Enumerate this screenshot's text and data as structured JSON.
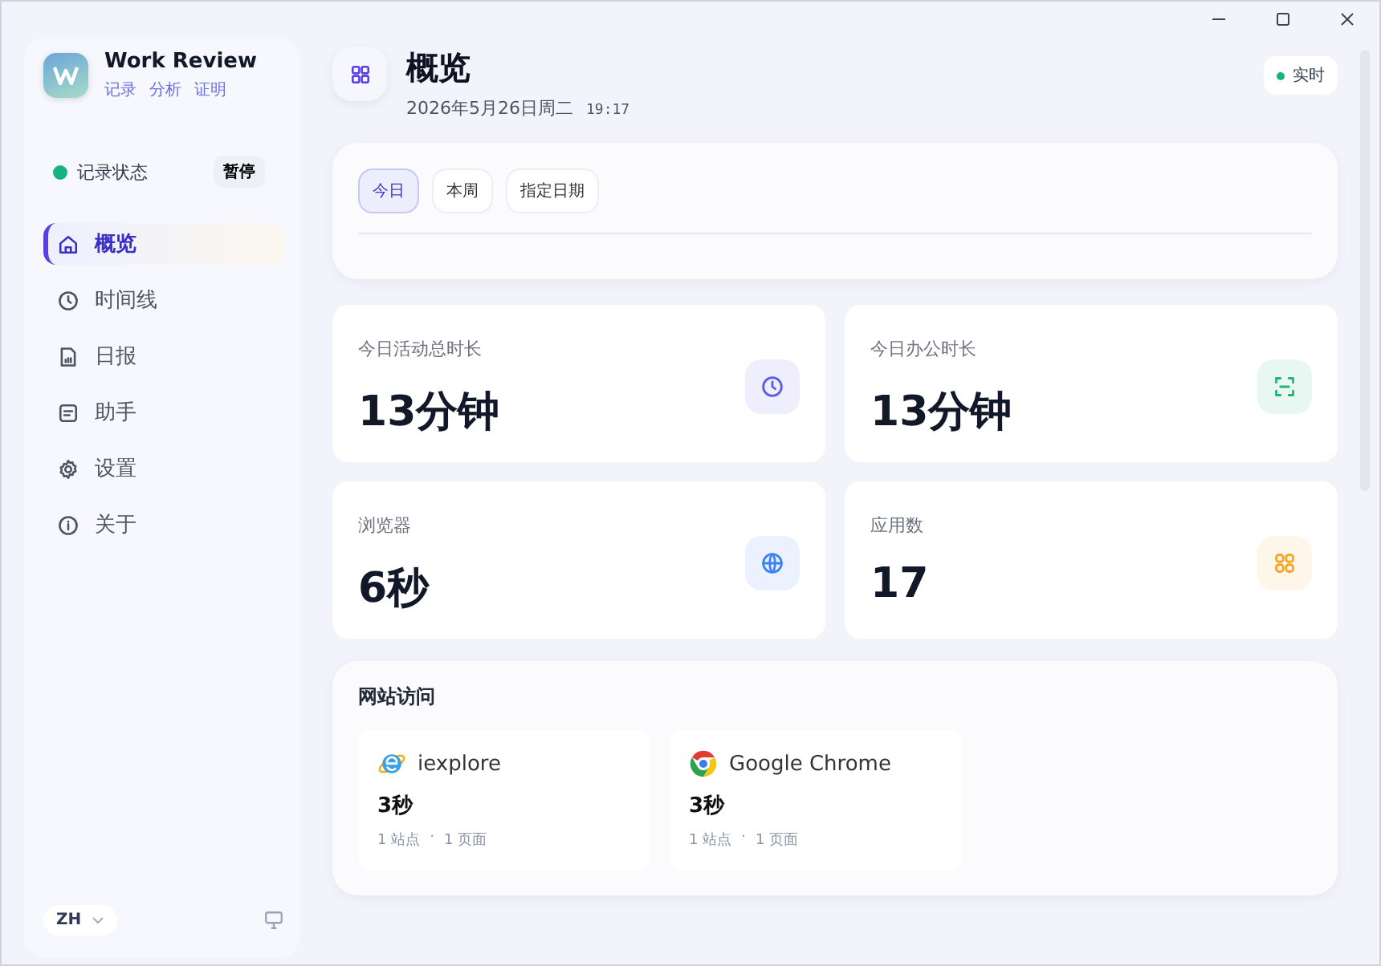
{
  "app": {
    "name": "Work Review",
    "links": [
      "记录",
      "分析",
      "证明"
    ]
  },
  "recording": {
    "label": "记录状态",
    "active": true,
    "action": "暂停"
  },
  "sidebar": {
    "items": [
      {
        "label": "概览",
        "selected": true
      },
      {
        "label": "时间线",
        "selected": false
      },
      {
        "label": "日报",
        "selected": false
      },
      {
        "label": "助手",
        "selected": false
      },
      {
        "label": "设置",
        "selected": false
      },
      {
        "label": "关于",
        "selected": false
      }
    ]
  },
  "language": {
    "value": "ZH"
  },
  "header": {
    "title": "概览",
    "date": "2026年5月26日周二",
    "time": "19:17",
    "live": {
      "label": "实时",
      "on": true
    }
  },
  "range_tabs": [
    {
      "label": "今日",
      "selected": true
    },
    {
      "label": "本周",
      "selected": false
    },
    {
      "label": "指定日期",
      "selected": false
    }
  ],
  "stats": [
    {
      "label": "今日活动总时长",
      "value": "13分钟",
      "color": "#5b5bf0"
    },
    {
      "label": "今日办公时长",
      "value": "13分钟",
      "color": "#22b573"
    },
    {
      "label": "浏览器",
      "value": "6秒",
      "color": "#3b82f6"
    },
    {
      "label": "应用数",
      "value": "17",
      "color": "#f5a623"
    }
  ],
  "websites": {
    "title": "网站访问",
    "items": [
      {
        "browser": "iexplore",
        "duration": "3秒",
        "sites": "1 站点",
        "separator": "·",
        "pages": "1 页面"
      },
      {
        "browser": "Google Chrome",
        "duration": "3秒",
        "sites": "1 站点",
        "separator": "·",
        "pages": "1 页面"
      }
    ]
  }
}
